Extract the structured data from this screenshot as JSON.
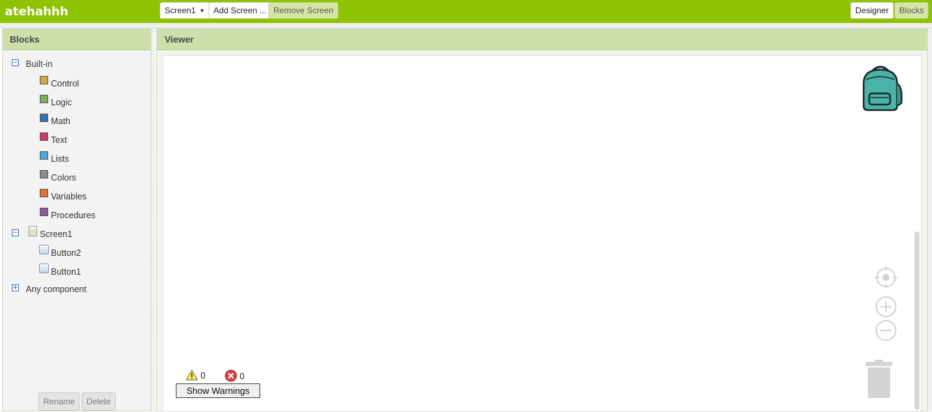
{
  "app": {
    "title": "atehahhh"
  },
  "toolbar": {
    "screen_select": "Screen1",
    "add_screen": "Add Screen ...",
    "remove_screen": "Remove Screen",
    "designer": "Designer",
    "blocks": "Blocks"
  },
  "blocks_panel": {
    "title": "Blocks",
    "built_in": {
      "label": "Built-in",
      "toggle": "−",
      "items": [
        {
          "label": "Control",
          "color": "#d4a94c"
        },
        {
          "label": "Logic",
          "color": "#7fb05a"
        },
        {
          "label": "Math",
          "color": "#3e6fb5"
        },
        {
          "label": "Text",
          "color": "#c6406b"
        },
        {
          "label": "Lists",
          "color": "#4aa9dc"
        },
        {
          "label": "Colors",
          "color": "#8c8c8c"
        },
        {
          "label": "Variables",
          "color": "#e36f35"
        },
        {
          "label": "Procedures",
          "color": "#8a5c9c"
        }
      ]
    },
    "screen": {
      "label": "Screen1",
      "toggle": "−",
      "components": [
        {
          "label": "Button2"
        },
        {
          "label": "Button1"
        }
      ]
    },
    "any_component": {
      "label": "Any component",
      "toggle": "+"
    },
    "rename": "Rename",
    "delete": "Delete"
  },
  "viewer": {
    "title": "Viewer",
    "warnings_count": "0",
    "errors_count": "0",
    "show_warnings": "Show Warnings"
  },
  "colors": {
    "topbar": "#8fc202",
    "panel_header": "#cde0aa",
    "backpack": "#4ab3a8"
  }
}
